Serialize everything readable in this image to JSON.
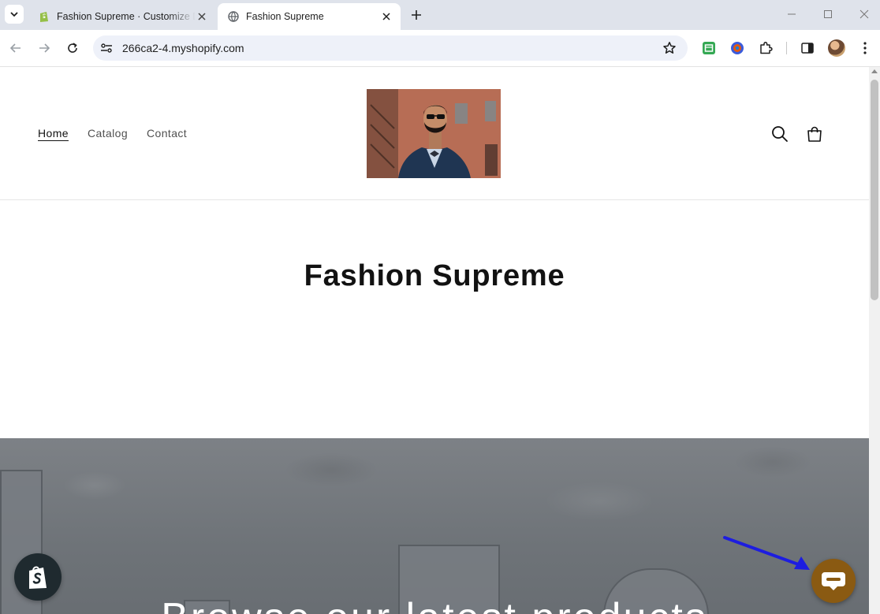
{
  "browser": {
    "tabs": [
      {
        "title": "Fashion Supreme · Customize D",
        "active": false
      },
      {
        "title": "Fashion Supreme",
        "active": true
      }
    ],
    "url": "266ca2-4.myshopify.com"
  },
  "store": {
    "nav": [
      {
        "label": "Home",
        "current": true
      },
      {
        "label": "Catalog",
        "current": false
      },
      {
        "label": "Contact",
        "current": false
      }
    ],
    "hero_title": "Fashion Supreme",
    "banner_text": "Browse our latest products"
  },
  "colors": {
    "chat_button": "#8a5a12",
    "annotation_arrow": "#1d1de0",
    "shopify_green": "#95bf47"
  },
  "icons": {
    "header": [
      "search-icon",
      "cart-icon"
    ],
    "floating": [
      "shopify-bag-icon",
      "chat-icon"
    ]
  }
}
